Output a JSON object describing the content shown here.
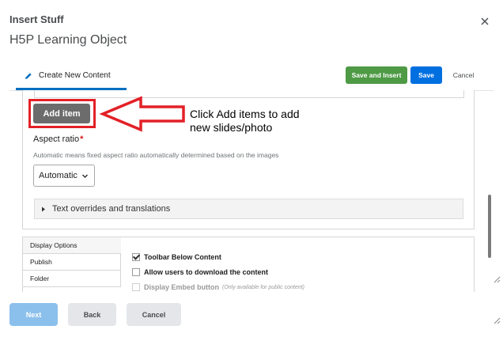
{
  "dialog": {
    "title": "Insert Stuff",
    "subtitle": "H5P Learning Object",
    "close_icon": "close-icon"
  },
  "tabs": [
    {
      "label": "Create New Content",
      "icon": "pencil-icon",
      "active": true
    }
  ],
  "toolbar": {
    "save_insert_label": "Save and Insert",
    "save_label": "Save",
    "cancel_label": "Cancel"
  },
  "editor": {
    "add_item_label": "Add item",
    "callout_text": "Click Add items to add new slides/photo",
    "aspect_ratio_label": "Aspect ratio",
    "required_marker": "*",
    "aspect_ratio_description": "Automatic means fixed aspect ratio automatically determined based on the images",
    "aspect_ratio_value": "Automatic",
    "overrides_label": "Text overrides and translations"
  },
  "settings": {
    "tabs": [
      {
        "label": "Display Options",
        "active": true
      },
      {
        "label": "Publish",
        "active": false
      },
      {
        "label": "Folder",
        "active": false
      }
    ],
    "options": [
      {
        "label": "Toolbar Below Content",
        "checked": true,
        "disabled": false,
        "note": ""
      },
      {
        "label": "Allow users to download the content",
        "checked": false,
        "disabled": false,
        "note": ""
      },
      {
        "label": "Display Embed button",
        "checked": false,
        "disabled": true,
        "note": "(Only available for public content)"
      }
    ]
  },
  "footer": {
    "next_label": "Next",
    "back_label": "Back",
    "cancel_label": "Cancel"
  },
  "colors": {
    "accent_blue": "#006fe0",
    "save_insert_green": "#4e9a45",
    "highlight_red": "#e32027",
    "tab_underline": "#006fbf"
  }
}
